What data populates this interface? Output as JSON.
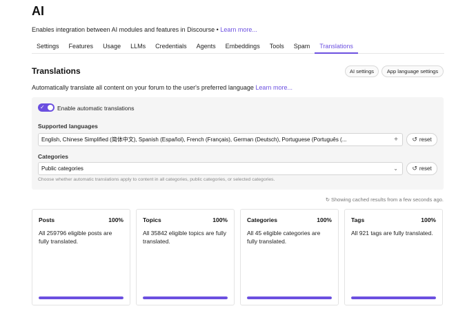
{
  "header": {
    "title": "AI",
    "description": "Enables integration between AI modules and features in Discourse •",
    "learn_more": "Learn more..."
  },
  "tabs": [
    {
      "label": "Settings"
    },
    {
      "label": "Features"
    },
    {
      "label": "Usage"
    },
    {
      "label": "LLMs"
    },
    {
      "label": "Credentials"
    },
    {
      "label": "Agents"
    },
    {
      "label": "Embeddings"
    },
    {
      "label": "Tools"
    },
    {
      "label": "Spam"
    },
    {
      "label": "Translations",
      "active": true
    }
  ],
  "section": {
    "title": "Translations",
    "ai_settings_button": "AI settings",
    "app_language_button": "App language settings",
    "description": "Automatically translate all content on your forum to the user's preferred language",
    "learn_more": "Learn more..."
  },
  "settings": {
    "toggle_label": "Enable automatic translations",
    "toggle_on": true,
    "languages_label": "Supported languages",
    "languages_value": "English, Chinese Simplified (简体中文), Spanish (Español), French (Français), German (Deutsch), Portuguese (Português (...",
    "categories_label": "Categories",
    "categories_value": "Public categories",
    "reset_label": "reset",
    "help_text": "Choose whether automatic translations apply to content in all categories, public categories, or selected categories."
  },
  "cache_note": "Showing cached results from a few seconds ago.",
  "cards": [
    {
      "title": "Posts",
      "percent": "100%",
      "text": "All 259796 eligible posts are fully translated.",
      "progress": 1.0
    },
    {
      "title": "Topics",
      "percent": "100%",
      "text": "All 35842 eligible topics are fully translated.",
      "progress": 1.0
    },
    {
      "title": "Categories",
      "percent": "100%",
      "text": "All 45 eligible categories are fully translated.",
      "progress": 1.0
    },
    {
      "title": "Tags",
      "percent": "100%",
      "text": "All 921 tags are fully translated.",
      "progress": 1.0
    }
  ],
  "icons": {
    "toggle_check": "check-icon",
    "add": "plus-icon",
    "dropdown": "chevron-down-icon",
    "reset": "undo-icon",
    "refresh": "refresh-icon"
  },
  "colors": {
    "accent": "#6b4fe0"
  }
}
